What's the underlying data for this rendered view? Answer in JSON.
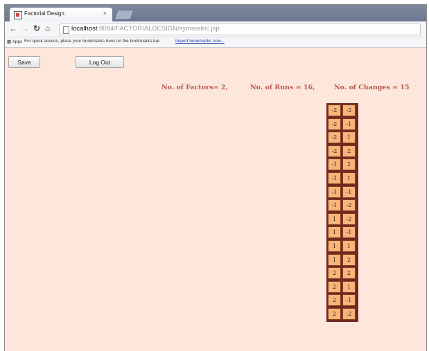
{
  "browser": {
    "tab_title": "Factorial Design",
    "tab_close": "×",
    "url_host": "localhost",
    "url_path": ":8084/FACTORIALDESIGN/symmetric.jsp",
    "bookmarks_apps": "Apps",
    "bookmarks_prompt": "For quick access, place your bookmarks here on the bookmarks bar.",
    "bookmarks_import": "Import bookmarks now..."
  },
  "actions": {
    "save_label": "Save",
    "logout_label": "Log Out"
  },
  "stats": {
    "factors": "No. of Factors= 2,",
    "runs": "No. of Runs = 16,",
    "changes": "No. of Changes = 15"
  },
  "design": {
    "rows": [
      [
        "-2",
        "-2"
      ],
      [
        "-2",
        "-1"
      ],
      [
        "-2",
        "1"
      ],
      [
        "-2",
        "2"
      ],
      [
        "-1",
        "2"
      ],
      [
        "-1",
        "1"
      ],
      [
        "-1",
        "-1"
      ],
      [
        "-1",
        "-2"
      ],
      [
        "1",
        "-2"
      ],
      [
        "1",
        "-1"
      ],
      [
        "1",
        "1"
      ],
      [
        "1",
        "2"
      ],
      [
        "2",
        "2"
      ],
      [
        "2",
        "1"
      ],
      [
        "2",
        "-1"
      ],
      [
        "2",
        "-2"
      ]
    ]
  }
}
